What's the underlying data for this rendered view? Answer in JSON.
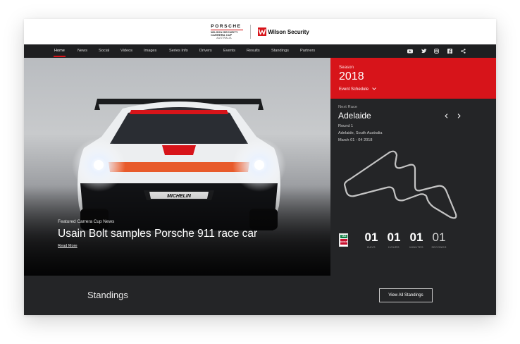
{
  "header": {
    "porsche_wordmark": "PORSCHE",
    "cup_line1": "WILSON SECURITY",
    "cup_line2": "CARRERA CUP",
    "cup_line3": "AUSTRALIA",
    "sponsor_name": "Wilson Security"
  },
  "nav": {
    "items": [
      "Home",
      "News",
      "Social",
      "Videos",
      "Images",
      "Series Info",
      "Drivers",
      "Events",
      "Results",
      "Standings",
      "Partners"
    ],
    "active": "Home",
    "social_icons": [
      "youtube-icon",
      "twitter-icon",
      "instagram-icon",
      "facebook-icon",
      "share-icon"
    ]
  },
  "hero": {
    "kicker": "Featured Carrera Cup News",
    "title": "Usain Bolt samples Porsche 911 race car",
    "link": "Read More"
  },
  "season": {
    "label": "Season",
    "year": "2018",
    "link": "Event Schedule"
  },
  "next_race": {
    "label": "Next Race",
    "city": "Adelaide",
    "round": "Round 1",
    "location": "Adelaide, South Australia",
    "dates": "March 01 - 04 2018"
  },
  "countdown": [
    {
      "value": "01",
      "label": "DAYS"
    },
    {
      "value": "01",
      "label": "HOURS"
    },
    {
      "value": "01",
      "label": "MINUTES"
    },
    {
      "value": "01",
      "label": "SECONDS"
    }
  ],
  "standings": {
    "title": "Standings",
    "button": "View All Standings"
  },
  "colors": {
    "accent_red": "#d7141a",
    "dark_panel": "#242527"
  }
}
